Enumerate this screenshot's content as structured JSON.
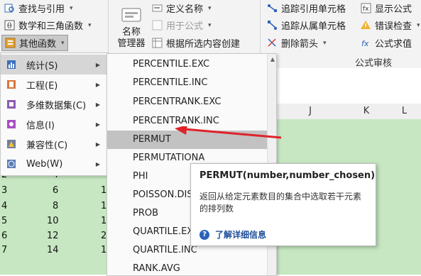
{
  "ribbon": {
    "left": {
      "lookup_ref": "查找与引用",
      "math_trig": "数学和三角函数",
      "other_funcs": "其他函数"
    },
    "names": {
      "name_manager": "名称\n管理器",
      "define_name": "定义名称",
      "use_in_formula": "用于公式",
      "create_from_selection": "根据所选内容创建"
    },
    "audit": {
      "trace_precedents": "追踪引用单元格",
      "trace_dependents": "追踪从属单元格",
      "remove_arrows": "删除箭头",
      "show_formulas": "显示公式",
      "error_checking": "错误检查",
      "evaluate_formula": "公式求值",
      "group_label": "公式审核"
    }
  },
  "menu1": {
    "items": [
      {
        "label": "统计(S)",
        "icon": "statistics-icon",
        "active": true
      },
      {
        "label": "工程(E)",
        "icon": "engineering-icon",
        "active": false
      },
      {
        "label": "多维数据集(C)",
        "icon": "cube-icon",
        "active": false
      },
      {
        "label": "信息(I)",
        "icon": "info-icon",
        "active": false
      },
      {
        "label": "兼容性(C)",
        "icon": "compatibility-icon",
        "active": false
      },
      {
        "label": "Web(W)",
        "icon": "web-icon",
        "active": false
      }
    ]
  },
  "menu2": {
    "items": [
      "PERCENTILE.EXC",
      "PERCENTILE.INC",
      "PERCENTRANK.EXC",
      "PERCENTRANK.INC",
      "PERMUT",
      "PERMUTATIONA",
      "PHI",
      "POISSON.DIST",
      "PROB",
      "QUARTILE.EXC",
      "QUARTILE.INC",
      "RANK.AVG"
    ],
    "active_index": 4
  },
  "tooltip": {
    "title": "PERMUT(number,number_chosen)",
    "description": "返回从给定元素数目的集合中选取若干元素的排列数",
    "help": "了解详细信息"
  },
  "sheet": {
    "columns": [
      "J",
      "K",
      "L"
    ],
    "col_a_values": [
      "2",
      "3",
      "4",
      "5",
      "6",
      "7"
    ],
    "col_b_values": [
      "4",
      "6",
      "8",
      "10",
      "12",
      "14"
    ],
    "col_c_values": [
      "1",
      "1",
      "1",
      "2",
      "1",
      "1"
    ]
  },
  "colors": {
    "green_cells": "#c6e7c1",
    "arrow": "#e0222a",
    "link": "#1f4e9a"
  }
}
